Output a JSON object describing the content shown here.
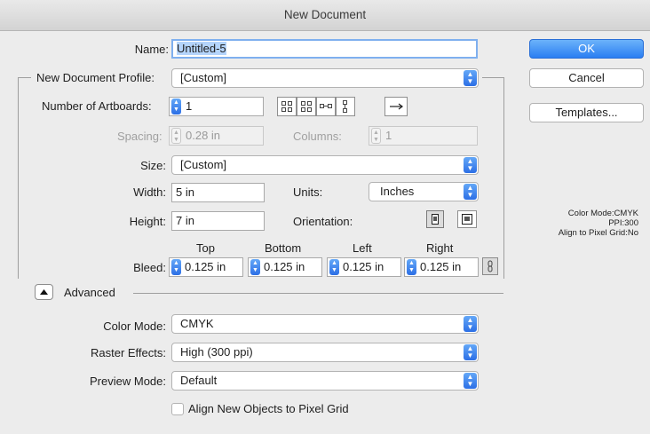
{
  "window": {
    "title": "New Document"
  },
  "name": {
    "label": "Name:",
    "value": "Untitled-5"
  },
  "profile": {
    "label": "New Document Profile:",
    "value": "[Custom]"
  },
  "artboards": {
    "label": "Number of Artboards:",
    "value": "1",
    "arrangement_icons": [
      "grid-by-row-icon",
      "grid-by-column-icon",
      "arrange-by-row-icon",
      "arrange-by-column-icon",
      "left-to-right-layout-icon"
    ]
  },
  "spacing": {
    "label": "Spacing:",
    "value": "0.28 in"
  },
  "columns": {
    "label": "Columns:",
    "value": "1"
  },
  "size": {
    "label": "Size:",
    "value": "[Custom]"
  },
  "width": {
    "label": "Width:",
    "value": "5 in"
  },
  "units": {
    "label": "Units:",
    "value": "Inches"
  },
  "height": {
    "label": "Height:",
    "value": "7 in"
  },
  "orientation": {
    "label": "Orientation:",
    "options": [
      "portrait-icon",
      "landscape-icon"
    ]
  },
  "bleed": {
    "label": "Bleed:",
    "top": {
      "label": "Top",
      "value": "0.125 in"
    },
    "bottom": {
      "label": "Bottom",
      "value": "0.125 in"
    },
    "left": {
      "label": "Left",
      "value": "0.125 in"
    },
    "right": {
      "label": "Right",
      "value": "0.125 in"
    },
    "link_icon": "link-icon"
  },
  "advanced": {
    "label": "Advanced",
    "color_mode": {
      "label": "Color Mode:",
      "value": "CMYK"
    },
    "raster_effects": {
      "label": "Raster Effects:",
      "value": "High (300 ppi)"
    },
    "preview_mode": {
      "label": "Preview Mode:",
      "value": "Default"
    },
    "align_pixel_grid": {
      "label": "Align New Objects to Pixel Grid",
      "checked": false
    }
  },
  "buttons": {
    "ok": "OK",
    "cancel": "Cancel",
    "templates": "Templates..."
  },
  "summary": {
    "line1": "Color Mode:CMYK",
    "line2": "PPI:300",
    "line3": "Align to Pixel Grid:No"
  },
  "colors": {
    "accent": "#2c6fe6",
    "background": "#ececec"
  }
}
